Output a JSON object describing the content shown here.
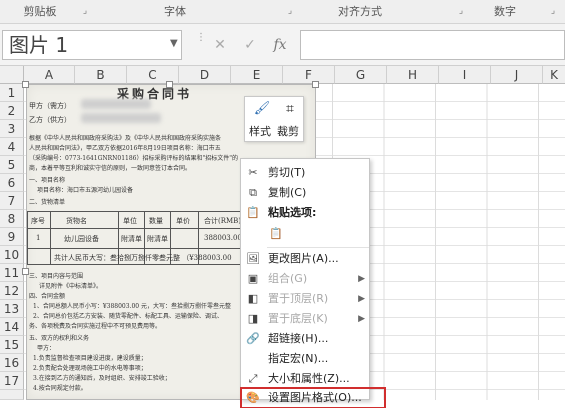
{
  "ribbon": {
    "groups": [
      "剪贴板",
      "字体",
      "对齐方式",
      "数字"
    ]
  },
  "formula_bar": {
    "name_box_value": "图片 1",
    "cancel_symbol": "✕",
    "enter_symbol": "✓",
    "fx_symbol": "fx"
  },
  "columns": [
    "A",
    "B",
    "C",
    "D",
    "E",
    "F",
    "G",
    "H",
    "I",
    "J",
    "K"
  ],
  "rows": [
    "1",
    "2",
    "3",
    "4",
    "5",
    "6",
    "7",
    "8",
    "9",
    "10",
    "11",
    "12",
    "13",
    "14",
    "15",
    "16",
    "17",
    "18",
    "19",
    "20",
    "21"
  ],
  "document": {
    "title": "采购合同书",
    "party_a": "甲方（需方）",
    "party_b": "乙方（供方）",
    "lines": [
      "根据《中华人民共和国政府采购法》及《中华人民共和国政府采购实施条",
      "人民共和国合同法》，甲乙双方依据2016年8月19日项目名称：海口市五",
      "（采购编号：0773-1641GNRN01186）招标采购评标的结果和\"招标文件\"的",
      "商，本着平等互利和诚实守信的原则，一致同意签订本合同。",
      "一、项目名称",
      "项目名称：海口市五源河幼儿园设备",
      "二、货物清单"
    ],
    "table_headers": [
      "序号",
      "货物名",
      "单位",
      "数量",
      "单价",
      "合计(RMB)"
    ],
    "table_row": [
      "1",
      "幼儿园设备",
      "附清单",
      "附清单",
      "",
      "388003.00"
    ],
    "table_total": "共计人民币大写：叁拾捌万捌仟零叁元整 （¥388003.00",
    "lines_after": [
      "三、项目内容与范围",
      "详见附件《中标清单》。",
      "四、合同金额",
      "1、合同总额人民币小写：¥388003.00 元，大写：叁拾捌万捌仟零叁元整",
      "2、合同总价包括乙方安装、随货零配件、标配工具、运输保险、调试、",
      "务、各项税费及合同实施过程中不可预见费用等。",
      "五、双方的权利和义务",
      "甲方：",
      "1.负责监督检查项目建设进度，建设质量；",
      "2.负责配合处理现场施工中的水电等事项；",
      "3.在接到乙方的通知后，及时组织、安排竣工验收；",
      "4.按合同规定付款。"
    ]
  },
  "mini_toolbar": {
    "style_label": "样式",
    "crop_label": "裁剪"
  },
  "context_menu": {
    "items": [
      {
        "label": "剪切(T)",
        "icon": "scissors-icon",
        "disabled": false
      },
      {
        "label": "复制(C)",
        "icon": "copy-icon",
        "disabled": false
      },
      {
        "label": "粘贴选项:",
        "icon": "paste-icon",
        "disabled": false
      },
      {
        "label": "",
        "icon": "paste-option-icon",
        "disabled": false
      },
      {
        "label": "更改图片(A)...",
        "icon": "change-picture-icon",
        "disabled": false
      },
      {
        "label": "组合(G)",
        "icon": "group-icon",
        "disabled": true,
        "submenu": true
      },
      {
        "label": "置于顶层(R)",
        "icon": "bring-front-icon",
        "disabled": true,
        "submenu": true
      },
      {
        "label": "置于底层(K)",
        "icon": "send-back-icon",
        "disabled": true,
        "submenu": true
      },
      {
        "label": "超链接(H)...",
        "icon": "hyperlink-icon",
        "disabled": false
      },
      {
        "label": "指定宏(N)...",
        "icon": "",
        "disabled": false
      },
      {
        "label": "大小和属性(Z)...",
        "icon": "size-properties-icon",
        "disabled": false
      },
      {
        "label": "设置图片格式(O)...",
        "icon": "format-picture-icon",
        "disabled": false
      }
    ]
  },
  "colors": {
    "highlight_border": "#d12e2e",
    "grid_line": "#dcdcdc"
  }
}
